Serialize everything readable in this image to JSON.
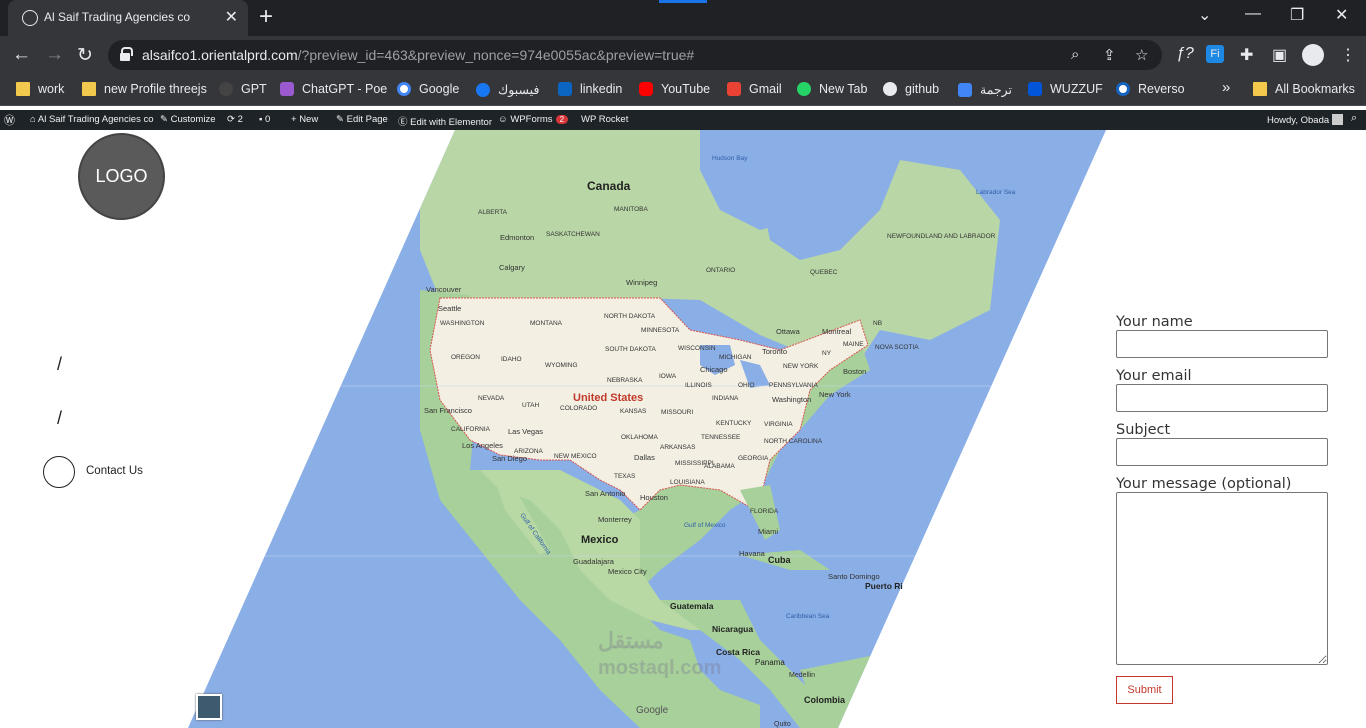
{
  "browser": {
    "tab_title": "Al Saif Trading Agencies co",
    "url_host": "alsaifco1.orientalprd.com",
    "url_rest": "/?preview_id=463&preview_nonce=974e0055ac&preview=true#",
    "bookmarks": [
      "work",
      "new Profile threejs",
      "GPT",
      "ChatGPT - Poe",
      "Google",
      "فيسبوك",
      "linkedin",
      "YouTube",
      "Gmail",
      "New Tab",
      "github",
      "ترجمة",
      "WUZZUF",
      "Reverso"
    ],
    "all_bookmarks": "All Bookmarks",
    "more": "»"
  },
  "adminbar": {
    "site": "Al Saif Trading Agencies co",
    "customize": "Customize",
    "updates": "2",
    "comments": "0",
    "new": "New",
    "edit_page": "Edit Page",
    "elementor": "Edit with Elementor",
    "wpforms": "WPForms",
    "wpforms_count": "2",
    "wprocket": "WP Rocket",
    "howdy": "Howdy, Obada"
  },
  "page": {
    "logo": "LOGO",
    "slash1": "/",
    "slash2": "/",
    "contact": "Contact Us",
    "watermark": "مستقل",
    "watermark_url": "mostaql.com",
    "google": "Google"
  },
  "map": {
    "labels": [
      "Hudson Bay",
      "Canada",
      "Labrador Sea",
      "MANITOBA",
      "ALBERTA",
      "Edmonton",
      "SASKATCHEWAN",
      "NEWFOUNDLAND AND LABRADOR",
      "Calgary",
      "ONTARIO",
      "QUEBEC",
      "Winnipeg",
      "Vancouver",
      "Seattle",
      "WASHINGTON",
      "MONTANA",
      "NORTH DAKOTA",
      "MINNESOTA",
      "Ottawa",
      "Montreal",
      "NB",
      "NOVA SCOTIA",
      "OREGON",
      "IDAHO",
      "SOUTH DAKOTA",
      "WISCONSIN",
      "MICHIGAN",
      "Toronto",
      "MAINE",
      "WYOMING",
      "NY",
      "Boston",
      "NEBRASKA",
      "IOWA",
      "Chicago",
      "NEW YORK",
      "NEVADA",
      "UTAH",
      "United States",
      "ILLINOIS",
      "OHIO",
      "PENNSYLVANIA",
      "New York",
      "San Francisco",
      "COLORADO",
      "KANSAS",
      "MISSOURI",
      "INDIANA",
      "Washington",
      "CALIFORNIA",
      "Las Vegas",
      "KENTUCKY",
      "VIRGINIA",
      "OKLAHOMA",
      "TENNESSEE",
      "NORTH CAROLINA",
      "Los Angeles",
      "ARIZONA",
      "ARKANSAS",
      "San Diego",
      "NEW MEXICO",
      "Dallas",
      "MISSISSIPPI",
      "ALABAMA",
      "GEORGIA",
      "TEXAS",
      "LOUISIANA",
      "San Antonio",
      "Houston",
      "FLORIDA",
      "Gulf of Mexico",
      "Monterrey",
      "Miami",
      "Mexico",
      "Havana",
      "Cuba",
      "Guadalajara",
      "Mexico City",
      "Santo Domingo",
      "Puerto Ri",
      "Guatemala",
      "Caribbean Sea",
      "Nicaragua",
      "Costa Rica",
      "Panama",
      "Medellin",
      "Colombia",
      "Quito",
      "Gulf of California"
    ]
  },
  "form": {
    "name_label": "Your name",
    "email_label": "Your email",
    "subject_label": "Subject",
    "message_label": "Your message (optional)",
    "submit": "Submit"
  },
  "colors": {
    "ocean": "#8aaee6",
    "land": "#a8d09a",
    "us": "#f3efe3",
    "border": "#d9534f",
    "submit": "#c0392b"
  }
}
